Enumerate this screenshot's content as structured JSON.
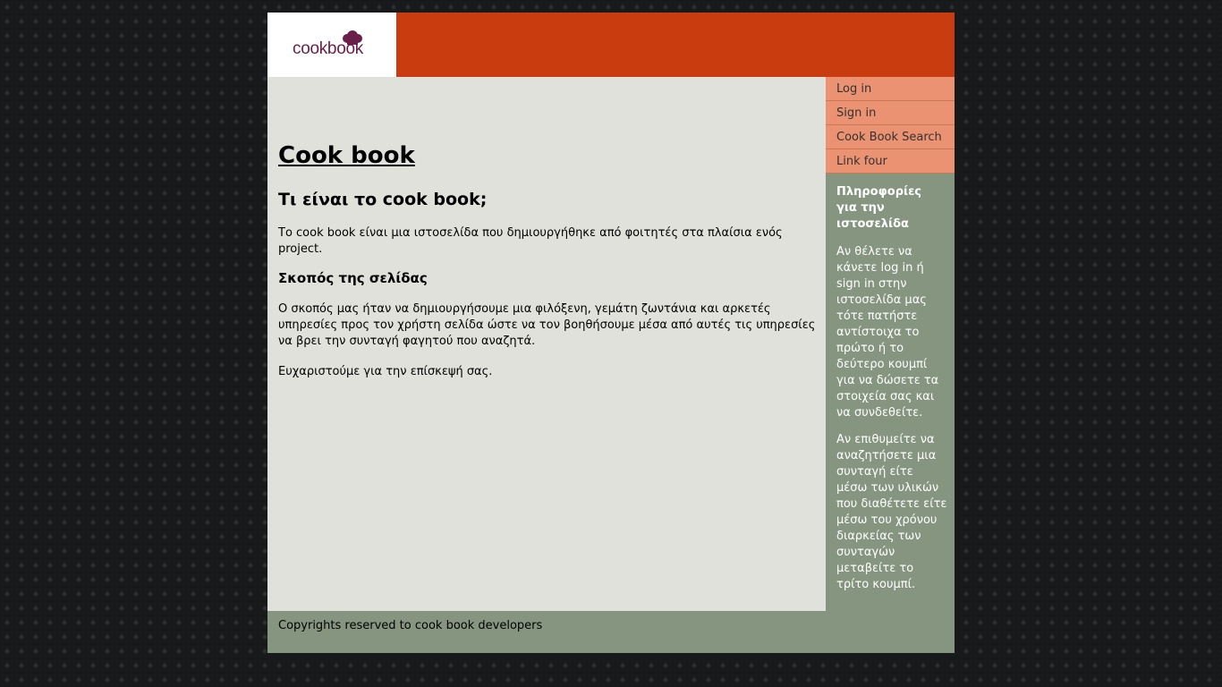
{
  "header": {
    "logo_text": "cookbook",
    "brand_color": "#c83c10"
  },
  "nav": {
    "items": [
      {
        "label": "Log in"
      },
      {
        "label": "Sign in"
      },
      {
        "label": "Cook Book Search"
      },
      {
        "label": "Link four"
      }
    ],
    "item_color": "#eb9272"
  },
  "main": {
    "title": "Cook book",
    "subtitle": "Τι είναι το cook book;",
    "intro": "Το cook book είναι μια ιστοσελίδα που δημιουργήθηκε από φοιτητές στα πλαίσια ενός project.",
    "section_title": "Σκοπός της σελίδας",
    "section_text": "Ο σκοπός μας ήταν να δημιουργήσουμε μια φιλόξενη, γεμάτη ζωντάνια και αρκετές υπηρεσίες προς τον χρήστη σελίδα ώστε να τον βοηθήσουμε μέσα από αυτές τις υπηρεσίες να βρει την συνταγή φαγητού που αναζητά.",
    "thanks": "Ευχαριστούμε για την επίσκεψή σας."
  },
  "sidebar": {
    "title": "Πληροφορίες για την ιστοσελίδα",
    "paragraph_1": "Αν θέλετε να κάνετε log in ή sign in στην ιστοσελίδα μας τότε πατήστε αντίστοιχα το πρώτο ή το δεύτερο κουμπί για να δώσετε τα στοιχεία σας και να συνδεθείτε.",
    "paragraph_2": "Αν επιθυμείτε να αναζητήσετε μια συνταγή είτε μέσω των υλικών που διαθέτετε είτε μέσω του χρόνου διαρκείας των συνταγών μεταβείτε το τρίτο κουμπί."
  },
  "footer": {
    "text": "Copyrights reserved to cook book developers"
  }
}
